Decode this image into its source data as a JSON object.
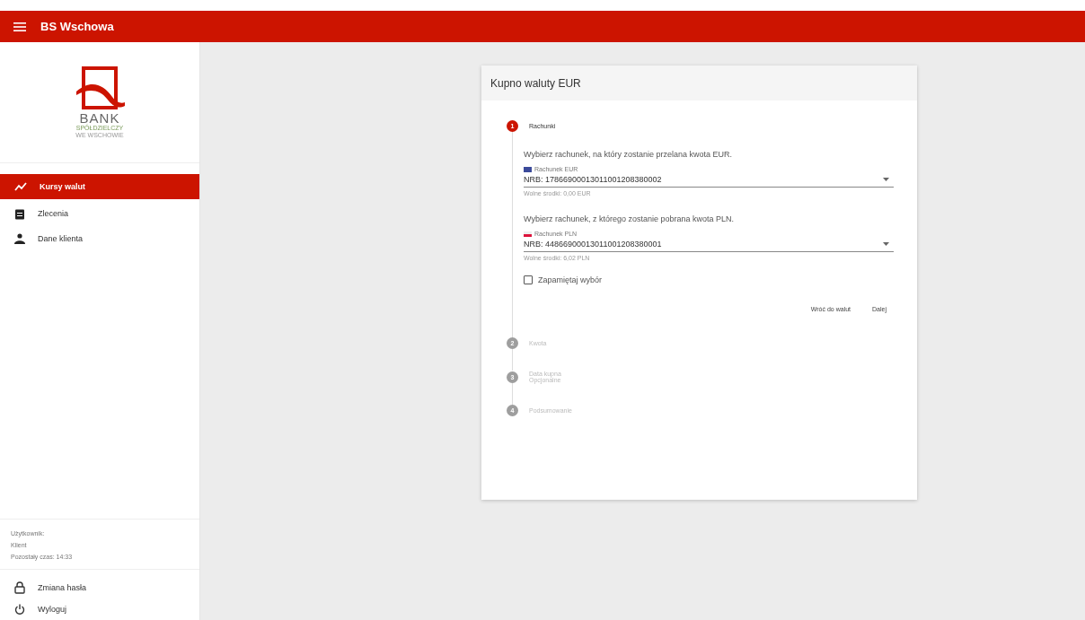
{
  "app_bar": {
    "title": "BS Wschowa"
  },
  "logo": {
    "word": "BANK",
    "line_1": "SPÓŁDZIELCZY",
    "line_2": "WE WSCHOWIE"
  },
  "nav": [
    {
      "label": "Kursy walut",
      "selected": true
    },
    {
      "label": "Zlecenia",
      "selected": false
    },
    {
      "label": "Dane klienta",
      "selected": false
    }
  ],
  "user_info": [
    "Użytkownik:",
    "Klient",
    "Pozostały czas: 14:33"
  ],
  "bottom_nav": [
    {
      "label": "Zmiana hasła"
    },
    {
      "label": "Wyloguj"
    }
  ],
  "card": {
    "title": "Kupno waluty EUR",
    "steps": [
      {
        "number": "1",
        "label": "Rachunki",
        "active": true
      },
      {
        "number": "2",
        "label": "Kwota",
        "active": false
      },
      {
        "number": "3",
        "label": "Data kupna",
        "subtitle": "Opcjonalne",
        "active": false
      },
      {
        "number": "4",
        "label": "Podsumowanie",
        "active": false
      }
    ],
    "fields": [
      {
        "prompt": "Wybierz rachunek, na który zostanie przelana kwota EUR.",
        "label": "Rachunek EUR",
        "value": "NRB: 17866900013011001208380002",
        "hint": "Wolne środki: 0,00 EUR"
      },
      {
        "prompt": "Wybierz rachunek, z którego zostanie pobrana kwota PLN.",
        "label": "Rachunek PLN",
        "value": "NRB: 44866900013011001208380001",
        "hint": "Wolne środki: 6,02 PLN"
      }
    ],
    "remember": {
      "label": "Zapamiętaj wybór",
      "checked": false
    },
    "buttons": [
      "Wróć do walut",
      "Dalej"
    ]
  }
}
